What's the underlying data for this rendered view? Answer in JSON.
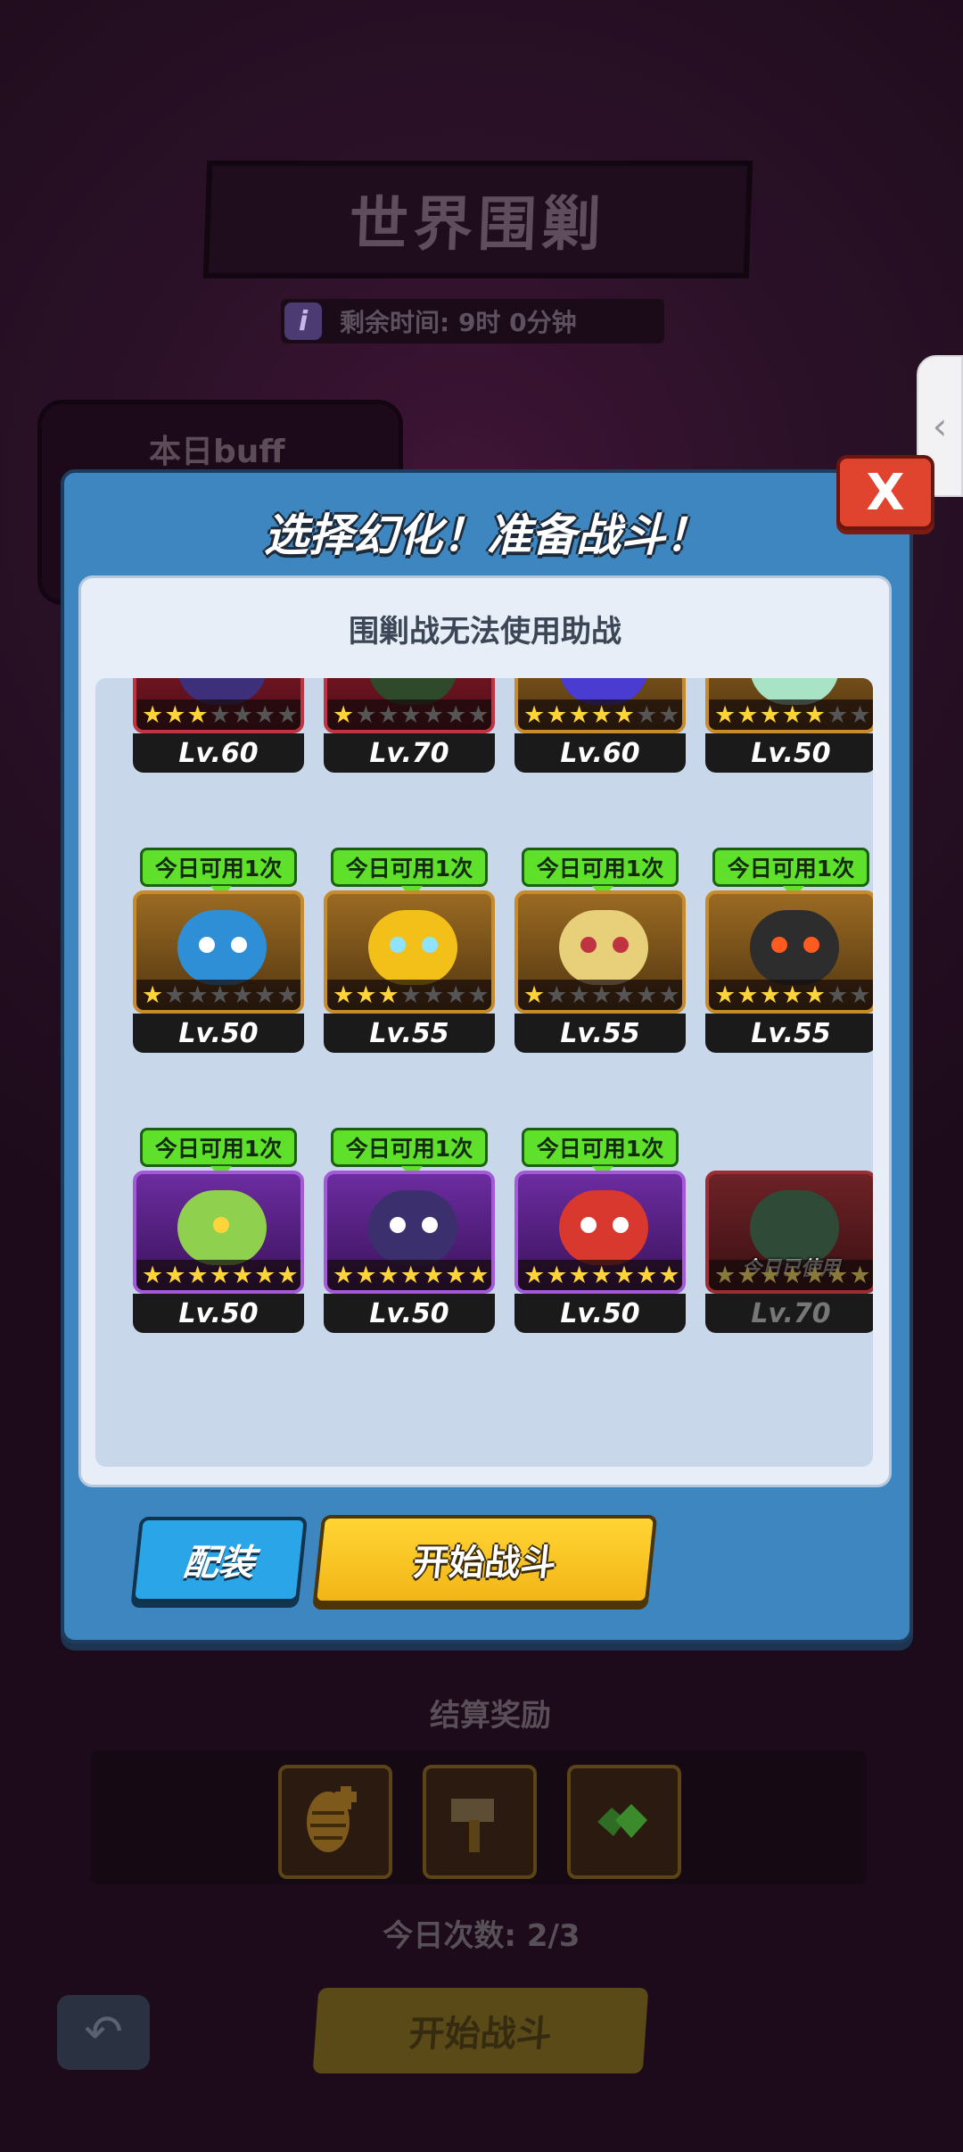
{
  "background": {
    "title": "世界围剿",
    "timer_text": "剩余时间: 9时 0分钟",
    "info_icon": "i",
    "buff_label": "本日buff",
    "settle_title": "结算奖励",
    "daily_count": "今日次数: 2/3",
    "start_label": "开始战斗",
    "back_icon": "undo-arrow-icon",
    "edge_tab_icon": "‹"
  },
  "modal": {
    "title": "选择幻化！准备战斗！",
    "close_label": "X",
    "note": "围剿战无法使用助战",
    "equip_label": "配装",
    "start_label": "开始战斗"
  },
  "cards": [
    {
      "level": "Lv.60",
      "stars": 3,
      "max_stars": 7,
      "badge": "",
      "used": ""
    },
    {
      "level": "Lv.70",
      "stars": 1,
      "max_stars": 7,
      "badge": "",
      "used": ""
    },
    {
      "level": "Lv.60",
      "stars": 5,
      "max_stars": 7,
      "badge": "",
      "used": ""
    },
    {
      "level": "Lv.50",
      "stars": 5,
      "max_stars": 7,
      "badge": "",
      "used": ""
    },
    {
      "level": "Lv.50",
      "stars": 1,
      "max_stars": 7,
      "badge": "今日可用1次",
      "used": ""
    },
    {
      "level": "Lv.55",
      "stars": 3,
      "max_stars": 7,
      "badge": "今日可用1次",
      "used": ""
    },
    {
      "level": "Lv.55",
      "stars": 1,
      "max_stars": 7,
      "badge": "今日可用1次",
      "used": ""
    },
    {
      "level": "Lv.55",
      "stars": 5,
      "max_stars": 7,
      "badge": "今日可用1次",
      "used": ""
    },
    {
      "level": "Lv.50",
      "stars": 7,
      "max_stars": 7,
      "badge": "今日可用1次",
      "used": ""
    },
    {
      "level": "Lv.50",
      "stars": 7,
      "max_stars": 7,
      "badge": "今日可用1次",
      "used": ""
    },
    {
      "level": "Lv.50",
      "stars": 7,
      "max_stars": 7,
      "badge": "今日可用1次",
      "used": ""
    },
    {
      "level": "Lv.70",
      "stars": 7,
      "max_stars": 7,
      "badge": "",
      "used": "今日已使用"
    }
  ],
  "rewards": [
    "pinecone-icon",
    "hammer-icon",
    "green-gem-icon"
  ]
}
